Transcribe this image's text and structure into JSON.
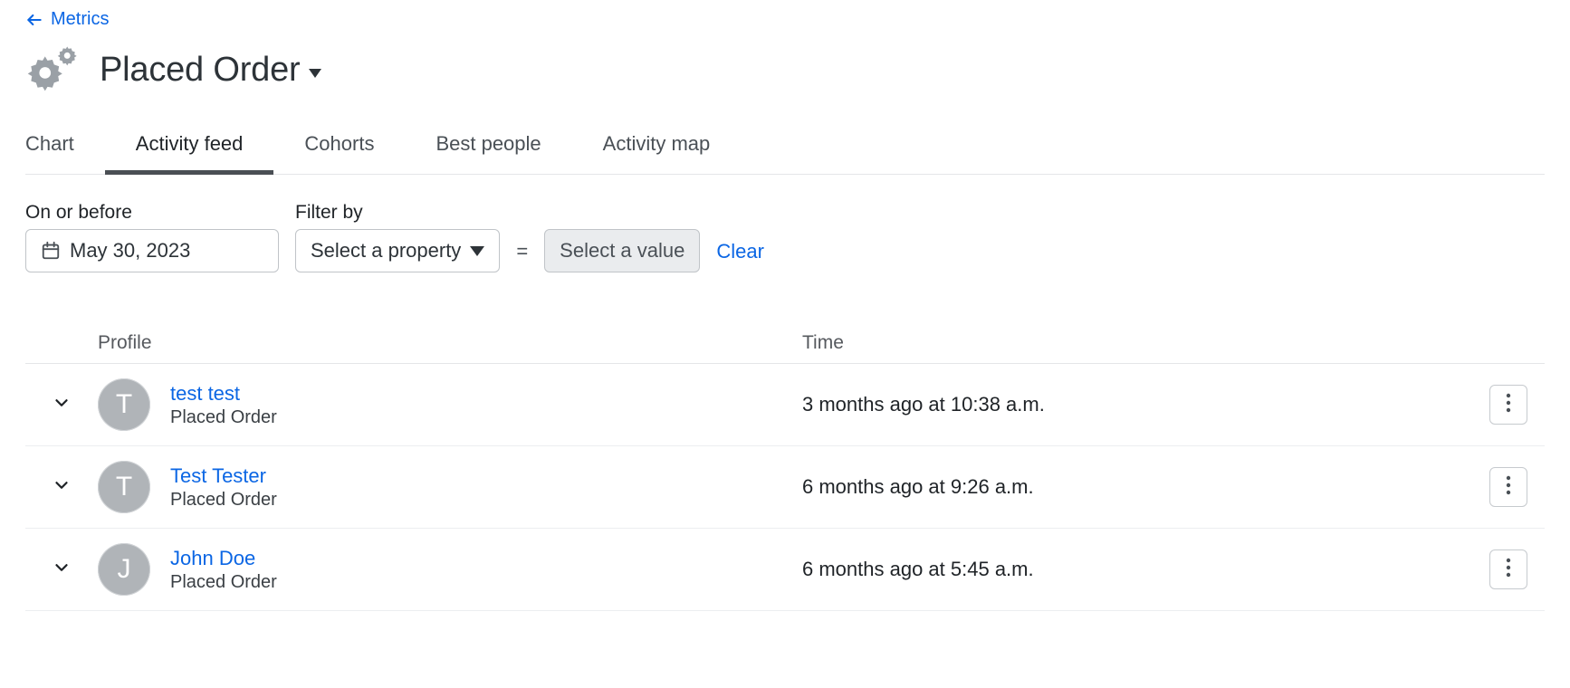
{
  "nav": {
    "back_label": "Metrics"
  },
  "header": {
    "title": "Placed Order"
  },
  "tabs": [
    {
      "label": "Chart",
      "active": false
    },
    {
      "label": "Activity feed",
      "active": true
    },
    {
      "label": "Cohorts",
      "active": false
    },
    {
      "label": "Best people",
      "active": false
    },
    {
      "label": "Activity map",
      "active": false
    }
  ],
  "filters": {
    "date_label": "On or before",
    "date_value": "May 30, 2023",
    "filter_label": "Filter by",
    "property_placeholder": "Select a property",
    "value_placeholder": "Select a value",
    "clear_label": "Clear"
  },
  "columns": {
    "profile": "Profile",
    "time": "Time"
  },
  "rows": [
    {
      "initial": "T",
      "name": "test test",
      "event": "Placed Order",
      "time": "3 months ago at 10:38 a.m."
    },
    {
      "initial": "T",
      "name": "Test Tester",
      "event": "Placed Order",
      "time": "6 months ago at 9:26 a.m."
    },
    {
      "initial": "J",
      "name": "John Doe",
      "event": "Placed Order",
      "time": "6 months ago at 5:45 a.m."
    }
  ]
}
